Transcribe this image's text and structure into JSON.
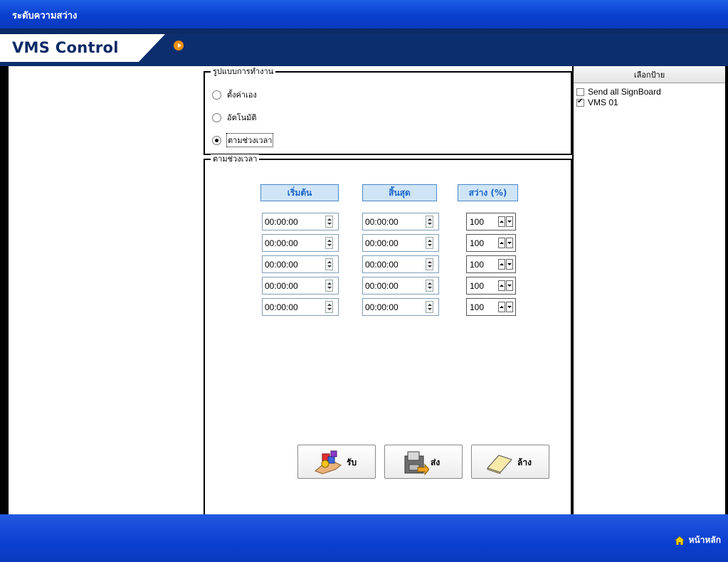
{
  "window": {
    "title": "ระดับความสว่าง"
  },
  "brand": {
    "name": "VMS Control"
  },
  "mode_group": {
    "legend": "รูปแบบการทำงาน",
    "options": [
      {
        "label": "ตั้งค่าเอง",
        "selected": false
      },
      {
        "label": "อัตโนมัติ",
        "selected": false
      },
      {
        "label": "ตามช่วงเวลา",
        "selected": true
      }
    ]
  },
  "schedule_group": {
    "legend": "ตามช่วงเวลา",
    "headers": {
      "start": "เริ่มต้น",
      "end": "สิ้นสุด",
      "brightness": "สว่าง (%)"
    },
    "rows": [
      {
        "start": "00:00:00",
        "end": "00:00:00",
        "brightness": "100"
      },
      {
        "start": "00:00:00",
        "end": "00:00:00",
        "brightness": "100"
      },
      {
        "start": "00:00:00",
        "end": "00:00:00",
        "brightness": "100"
      },
      {
        "start": "00:00:00",
        "end": "00:00:00",
        "brightness": "100"
      },
      {
        "start": "00:00:00",
        "end": "00:00:00",
        "brightness": "100"
      }
    ],
    "buttons": {
      "receive": "รับ",
      "send": "ส่ง",
      "clear": "ล้าง"
    }
  },
  "sign_panel": {
    "header": "เลือกป้าย",
    "items": [
      {
        "label": "Send all SignBoard",
        "checked": false
      },
      {
        "label": "VMS 01",
        "checked": true
      }
    ]
  },
  "footer": {
    "home_label": "หน้าหลัก"
  },
  "colors": {
    "titlebar": "#0a3fd0",
    "band": "#0d2e6e",
    "header_fill": "#cfe5f6",
    "header_text": "#1a64c8",
    "accent_orange": "#f0900a"
  }
}
